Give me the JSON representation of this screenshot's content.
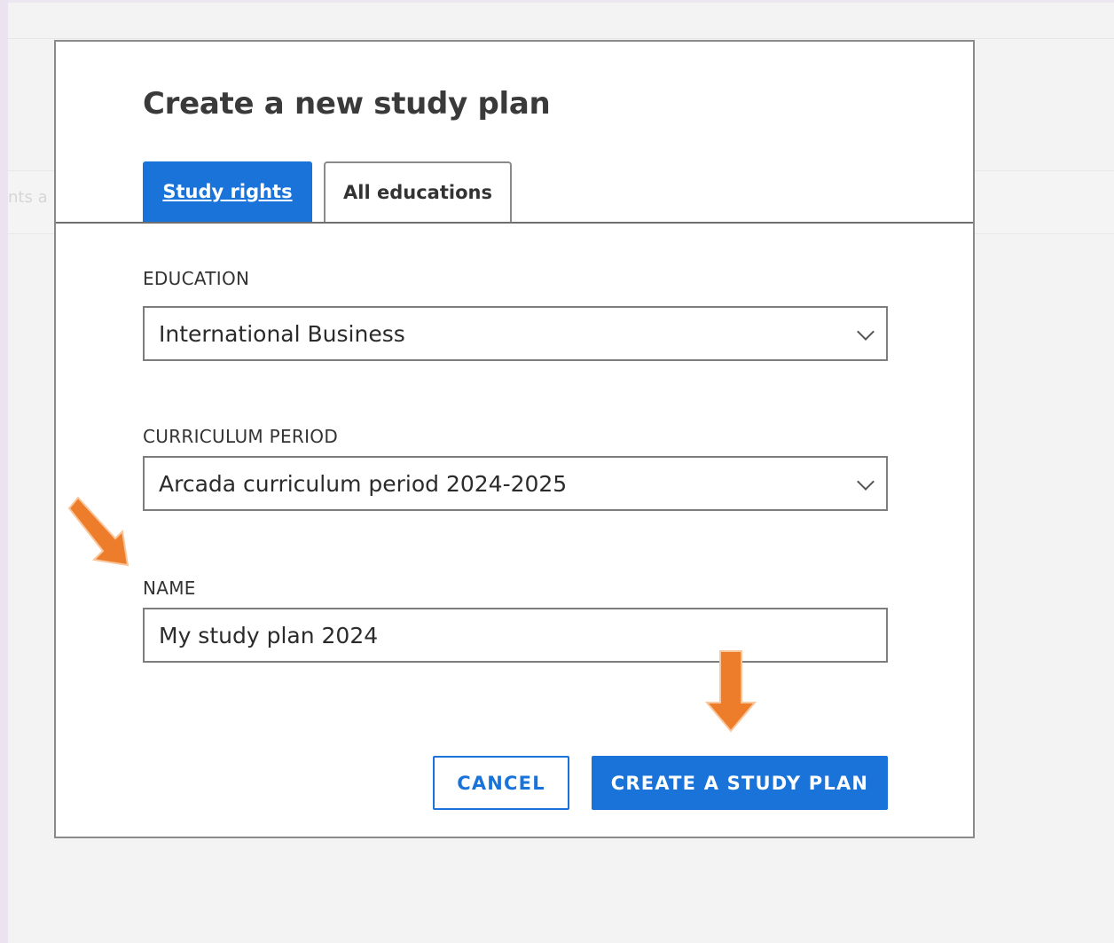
{
  "background": {
    "ghost_text": "nts a"
  },
  "dialog": {
    "title": "Create a new study plan",
    "tabs": [
      {
        "label": "Study rights",
        "active": true
      },
      {
        "label": "All educations",
        "active": false
      }
    ],
    "education": {
      "label": "EDUCATION",
      "value": "International Business"
    },
    "curriculum_period": {
      "label": "CURRICULUM PERIOD",
      "value": "Arcada curriculum period 2024-2025"
    },
    "name": {
      "label": "NAME",
      "value": "My study plan 2024"
    },
    "buttons": {
      "cancel": "CANCEL",
      "create": "CREATE A STUDY PLAN"
    }
  },
  "annotations": {
    "arrow_color": "#ee7d2b"
  },
  "colors": {
    "accent": "#1a73d9",
    "annotation": "#ee7d2b"
  }
}
